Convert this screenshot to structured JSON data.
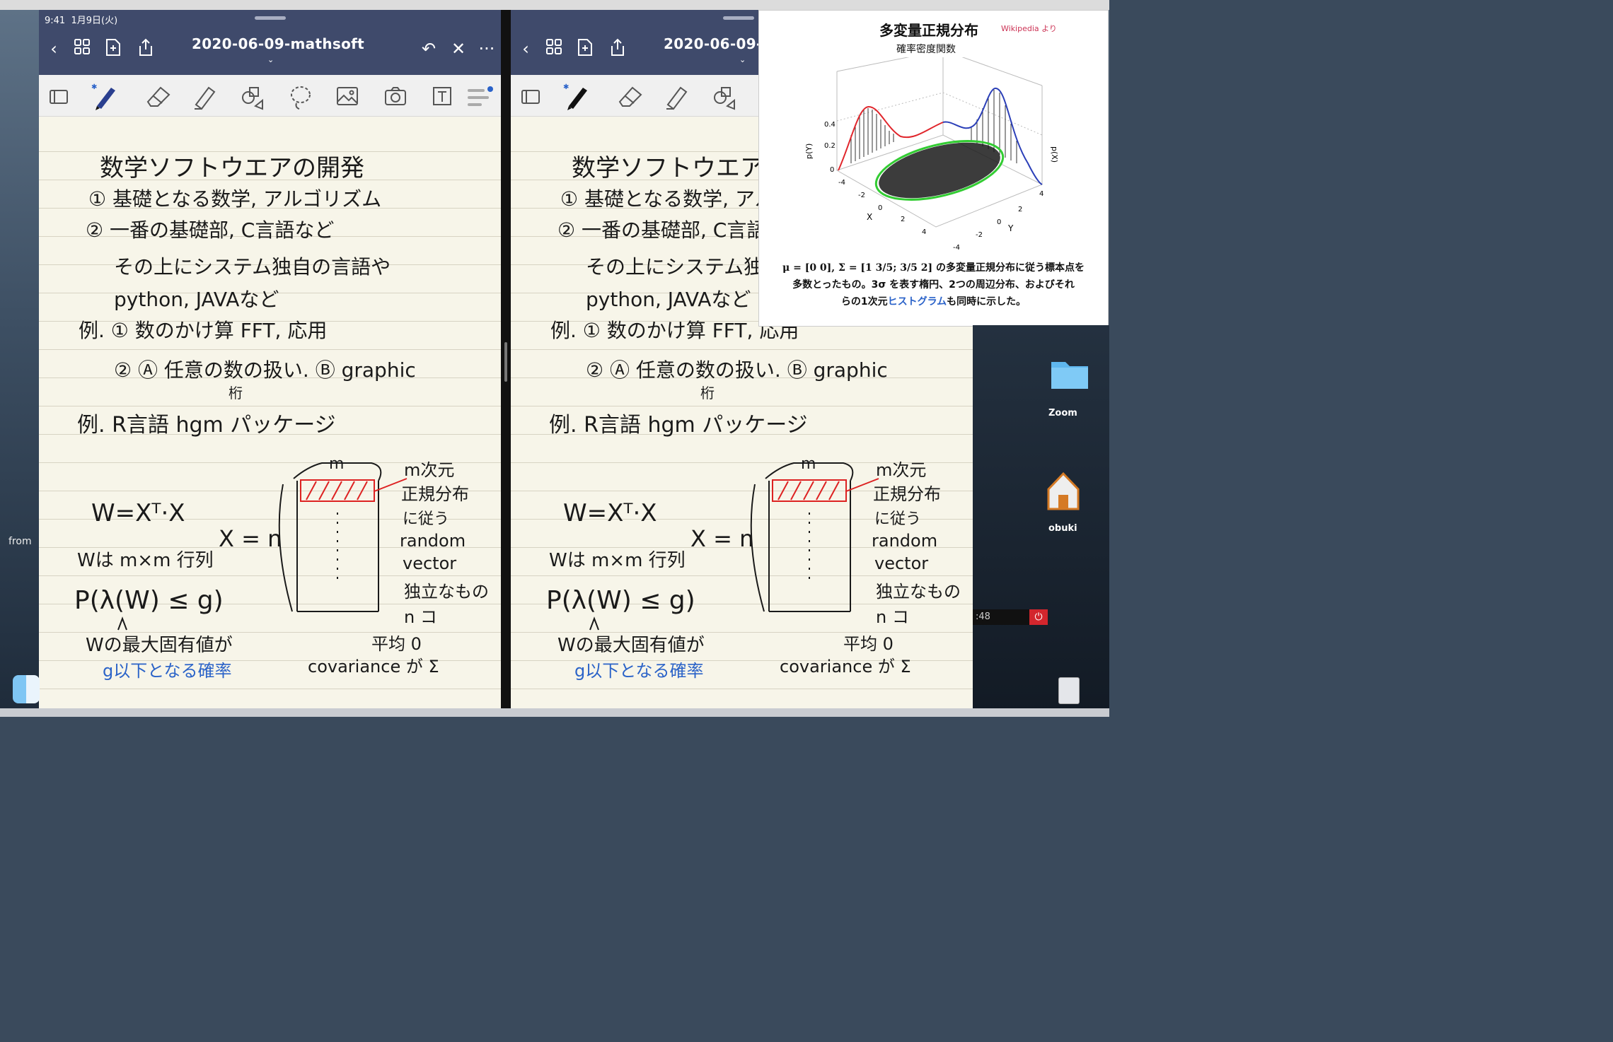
{
  "desktop": {
    "side_left_label": "from",
    "dock_labels": [
      "Zoom",
      "obuki"
    ],
    "clock_text": ":48"
  },
  "ipad": {
    "status": {
      "time": "9:41",
      "date": "1月9日(火)"
    },
    "left": {
      "title": "2020-06-09-mathsoft"
    },
    "right": {
      "title": "2020-06-09-"
    }
  },
  "note": {
    "lines": [
      "数学ソフトウエアの開発",
      "① 基礎となる数学, アルゴリズム",
      "② 一番の基礎部, C言語など",
      "その上にシステム独自の言語や",
      "python, JAVAなど",
      "例. ① 数のかけ算 FFT, 応用",
      "② Ⓐ 任意の数の扱い. Ⓑ graphic",
      "桁",
      "例. R言語 hgm パッケージ",
      "W=Xᵀ·X",
      "Wは m×m 行列",
      "P(λ(W) ≤ g)",
      "X = n",
      "m",
      "m次元",
      "正規分布",
      "に従う",
      "random",
      "vector",
      "独立なもの",
      "n コ",
      "平均 0",
      "covariance が Σ",
      "Wの最大固有値が",
      "g以下となる確率"
    ]
  },
  "wiki": {
    "title": "多変量正規分布",
    "source": "Wikipedia より",
    "plot_title": "確率密度関数",
    "axis_py": "p(Y)",
    "axis_px": "p(X)",
    "axis_x": "X",
    "axis_y": "Y",
    "z_ticks": [
      "0.4",
      "0.2",
      "0"
    ],
    "x_ticks": [
      "-4",
      "-2",
      "0",
      "2",
      "4"
    ],
    "y_ticks": [
      "4",
      "2",
      "0",
      "-2",
      "-4"
    ],
    "caption_formula": "μ = [0 0], Σ = [1 3/5; 3/5 2]",
    "caption_1": "の多変量正規分布に従う標本点を",
    "caption_2": "多数とったもの。3σ を表す楕円、2つの周辺分布、およびそれ",
    "caption_3a": "らの1次元",
    "caption_link": "ヒストグラム",
    "caption_3b": "も同時に示した。",
    "colors": {
      "curve_red": "#e0262c",
      "curve_blue": "#2b3fb8",
      "ellipse": "#33cc33"
    }
  }
}
